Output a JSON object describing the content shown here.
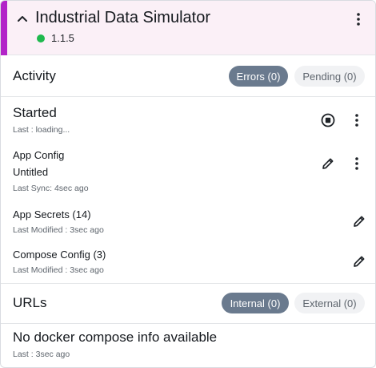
{
  "header": {
    "title": "Industrial Data Simulator",
    "version": "1.1.5",
    "status_color": "#1fb94e",
    "accent_color": "#b224c8",
    "collapse_icon": "chevron-up-icon",
    "menu_icon": "kebab-menu-icon"
  },
  "activity": {
    "title": "Activity",
    "errors_label": "Errors (0)",
    "pending_label": "Pending (0)"
  },
  "started": {
    "title": "Started",
    "last": "Last : loading...",
    "stop_icon": "stop-circle-icon",
    "menu_icon": "kebab-menu-icon"
  },
  "app_config": {
    "title": "App Config",
    "value": "Untitled",
    "last_sync": "Last Sync: 4sec ago",
    "edit_icon": "pencil-icon",
    "menu_icon": "kebab-menu-icon"
  },
  "app_secrets": {
    "title": "App Secrets (14)",
    "last_modified": "Last Modified : 3sec ago",
    "edit_icon": "pencil-icon"
  },
  "compose_config": {
    "title": "Compose Config (3)",
    "last_modified": "Last Modified : 3sec ago",
    "edit_icon": "pencil-icon"
  },
  "urls": {
    "title": "URLs",
    "internal_label": "Internal (0)",
    "external_label": "External (0)"
  },
  "compose_info": {
    "message": "No docker compose info available",
    "last": "Last : 3sec ago"
  }
}
